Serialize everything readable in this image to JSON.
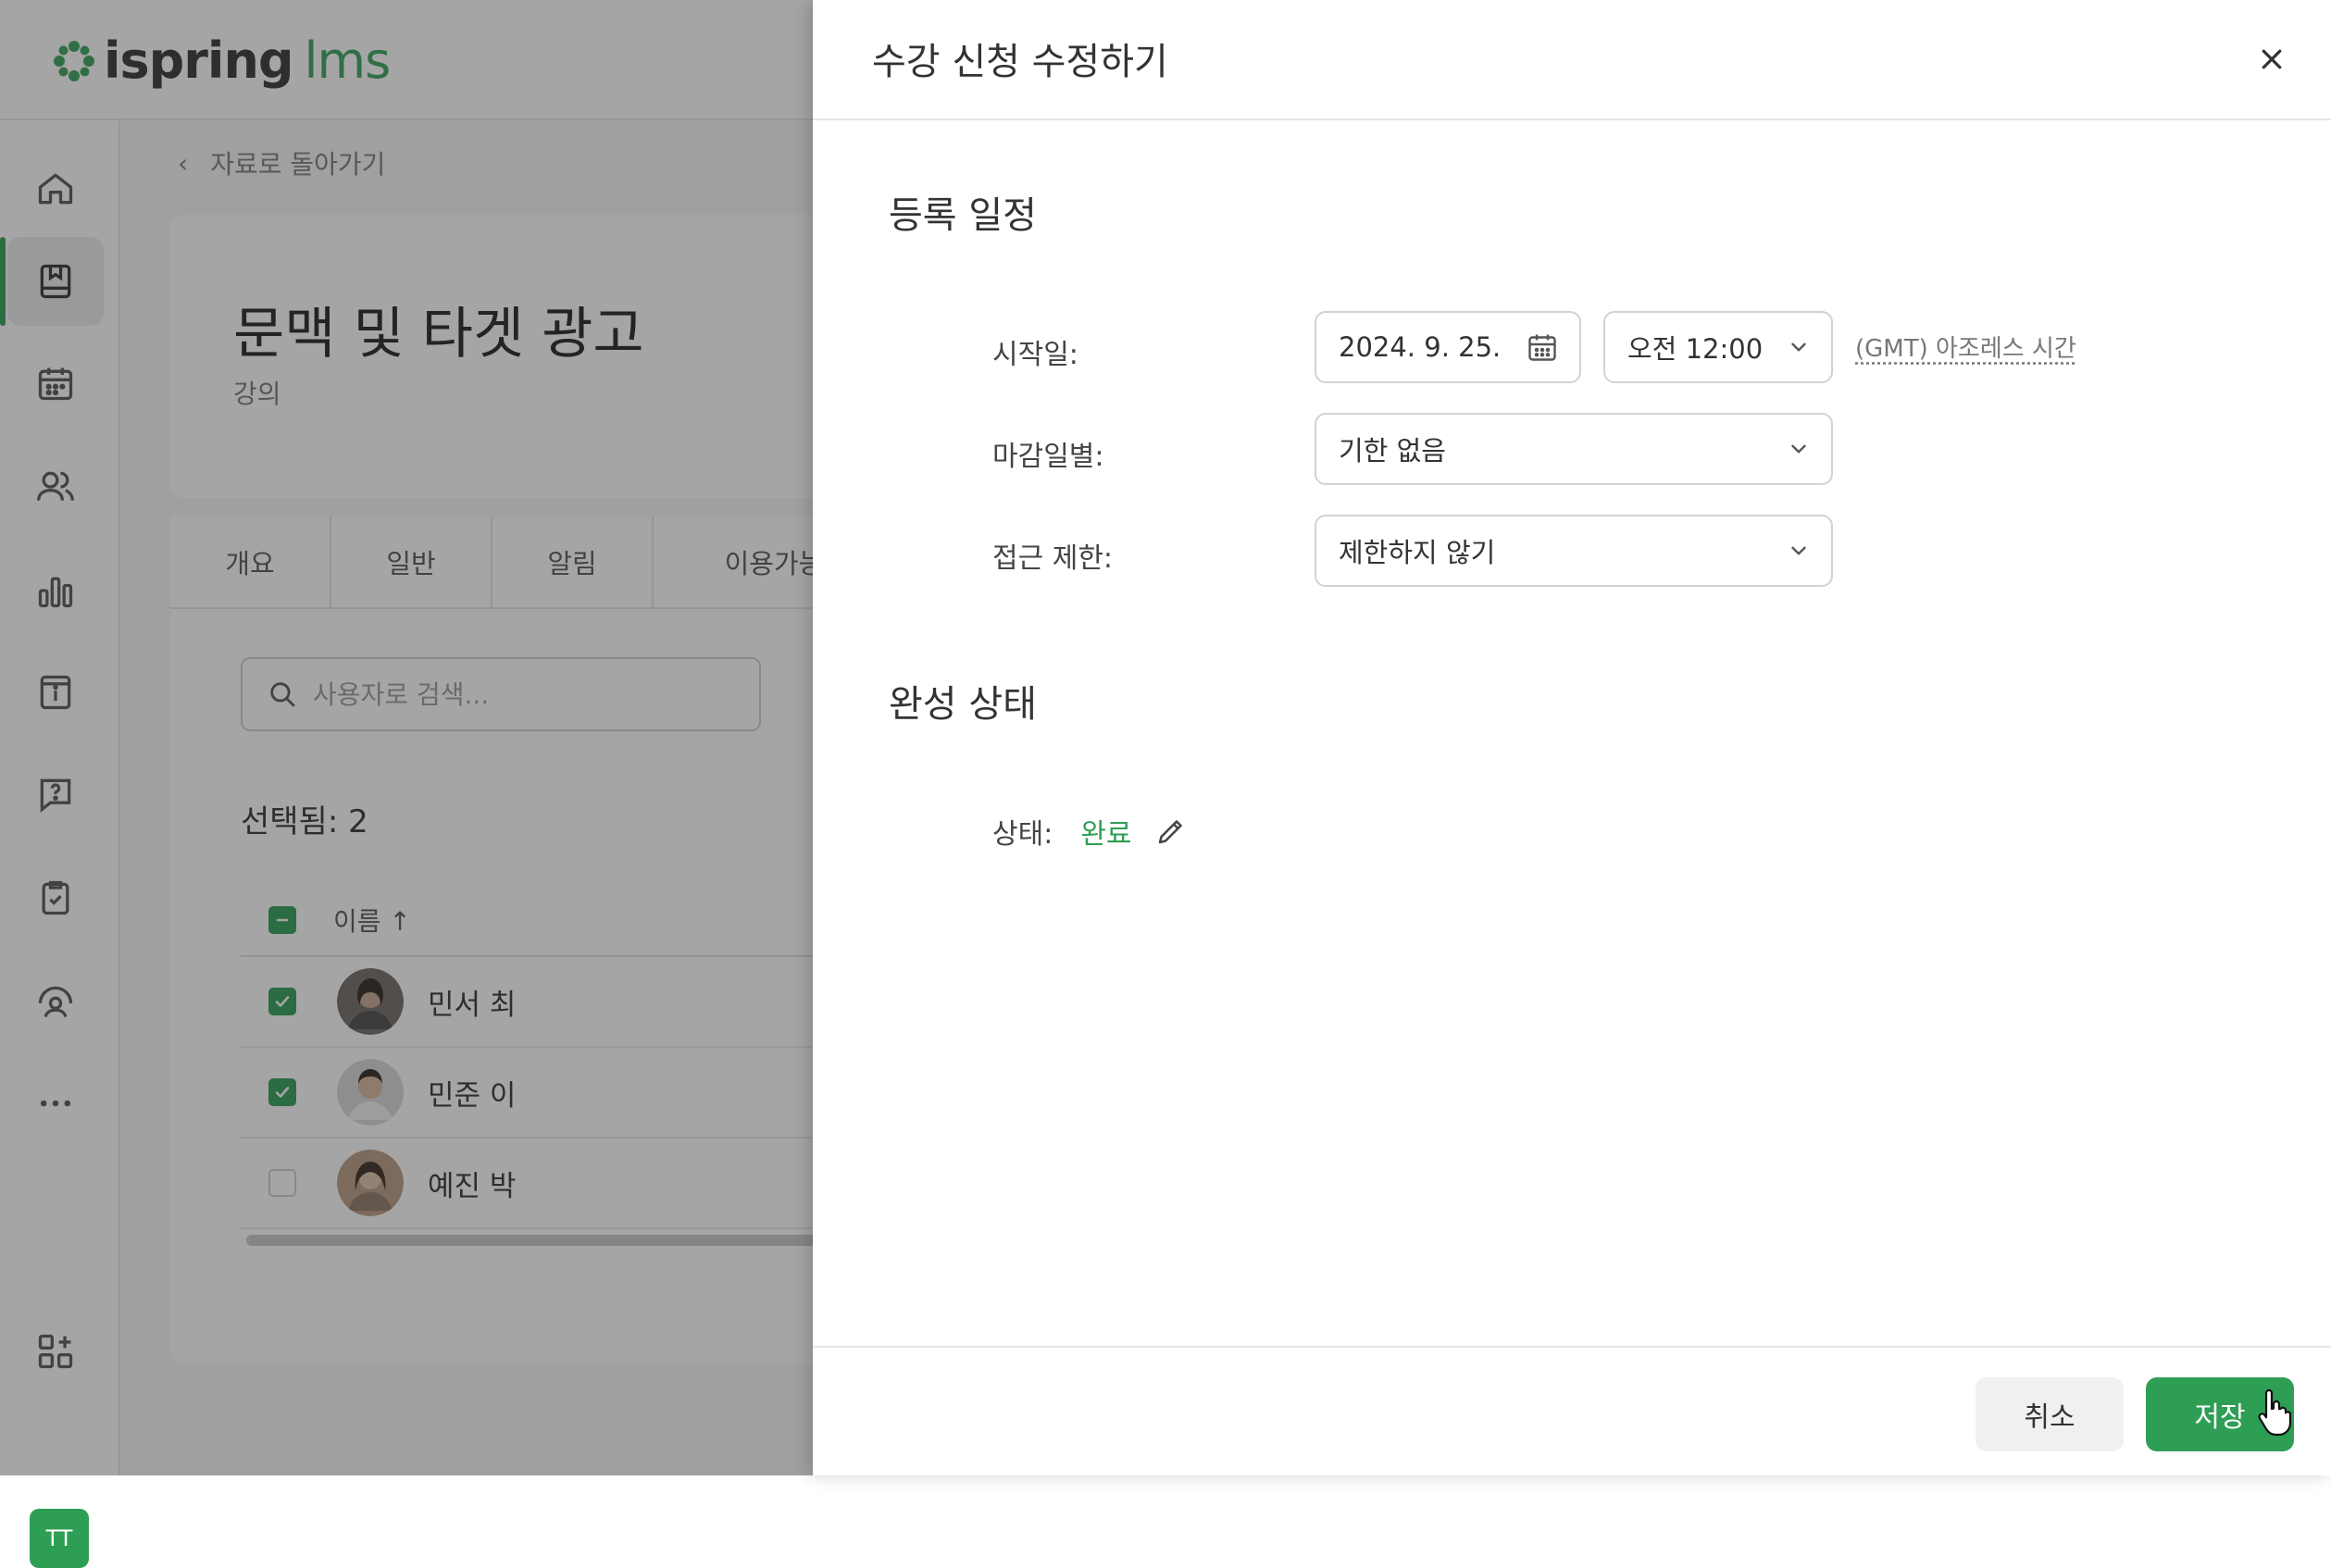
{
  "app": {
    "logo_left": "ispring",
    "logo_right": "lms",
    "user_initials": "TT"
  },
  "sidebar": {
    "items": [
      {
        "name": "home-icon"
      },
      {
        "name": "courses-icon",
        "active": true
      },
      {
        "name": "calendar-icon"
      },
      {
        "name": "users-icon"
      },
      {
        "name": "reports-icon"
      },
      {
        "name": "info-icon"
      },
      {
        "name": "help-icon"
      },
      {
        "name": "tasks-icon"
      },
      {
        "name": "support-icon"
      },
      {
        "name": "more-icon"
      },
      {
        "name": "add-apps-icon"
      }
    ]
  },
  "page": {
    "back_link": "자료로 돌아가기",
    "course_title": "문맥 및 타겟 광고",
    "course_type": "강의",
    "tabs": [
      "개요",
      "일반",
      "알림",
      "이용가능"
    ],
    "search_placeholder": "사용자로 검색...",
    "selected_count": "선택됨: 2",
    "column_name": "이름 ↑",
    "users": [
      {
        "name": "민서 최",
        "checked": true
      },
      {
        "name": "민준 이",
        "checked": true
      },
      {
        "name": "예진 박",
        "checked": false
      }
    ]
  },
  "dialog": {
    "title": "수강 신청 수정하기",
    "schedule_section": "등록 일정",
    "start_label": "시작일:",
    "start_date": "2024. 9. 25.",
    "start_time": "오전 12:00",
    "timezone": "(GMT) 아조레스 시간",
    "due_label": "마감일별:",
    "due_value": "기한 없음",
    "access_label": "접근 제한:",
    "access_value": "제한하지 않기",
    "completion_section": "완성 상태",
    "status_label": "상태:",
    "status_value": "완료",
    "cancel_label": "취소",
    "save_label": "저장"
  },
  "colors": {
    "accent": "#2f9e55",
    "overlay": "rgba(40,40,40,0.42)"
  }
}
